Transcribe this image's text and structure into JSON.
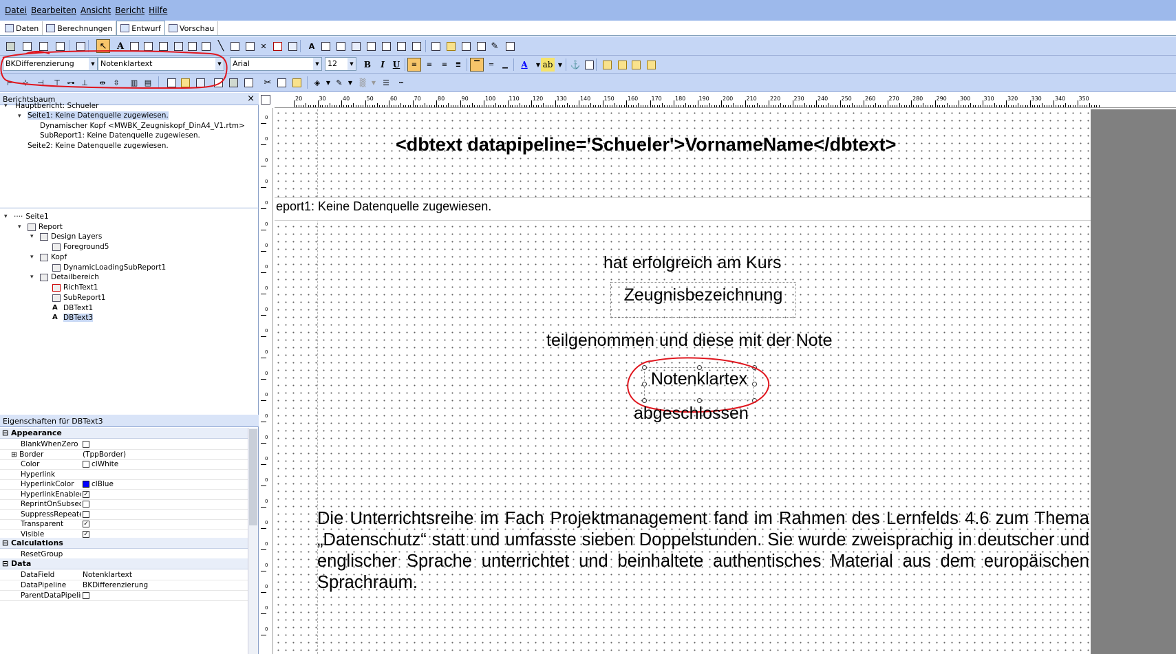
{
  "menu": [
    "Datei",
    "Bearbeiten",
    "Ansicht",
    "Bericht",
    "Hilfe"
  ],
  "tabs": [
    "Daten",
    "Berechnungen",
    "Entwurf",
    "Vorschau"
  ],
  "toolbar": {
    "pipeline": "BKDifferenzierung",
    "field": "Notenklartext",
    "font": "Arial",
    "size": "12",
    "bold": "B",
    "italic": "I",
    "underline": "U",
    "font_color_glyph": "A"
  },
  "tree": {
    "title": "Berichtsbaum",
    "close": "×",
    "nodes": [
      "Hauptbericht: Schueler",
      "Seite1: Keine Datenquelle zugewiesen.",
      "Dynamischer Kopf <MWBK_Zeugniskopf_DinA4_V1.rtm>",
      "SubReport1: Keine Datenquelle zugewiesen.",
      "Seite2: Keine Datenquelle zugewiesen."
    ]
  },
  "objects": [
    "Seite1",
    "Report",
    "Design Layers",
    "Foreground5",
    "Kopf",
    "DynamicLoadingSubReport1",
    "Detailbereich",
    "RichText1",
    "SubReport1",
    "DBText1",
    "DBText3"
  ],
  "props": {
    "title": "Eigenschaften für DBText3",
    "cat_appearance": "Appearance",
    "cat_calculations": "Calculations",
    "cat_data": "Data",
    "rows": [
      {
        "name": "BlankWhenZero",
        "value": "",
        "check": ""
      },
      {
        "name": "Border",
        "value": "(TppBorder)",
        "check": "none"
      },
      {
        "name": "Color",
        "value": "clWhite",
        "check": ""
      },
      {
        "name": "Hyperlink",
        "value": "",
        "check": "none"
      },
      {
        "name": "HyperlinkColor",
        "value": "clBlue",
        "check": "swatch"
      },
      {
        "name": "HyperlinkEnabled",
        "value": "",
        "check": "✓"
      },
      {
        "name": "ReprintOnSubsequ",
        "value": "",
        "check": ""
      },
      {
        "name": "SuppressRepeatec",
        "value": "",
        "check": ""
      },
      {
        "name": "Transparent",
        "value": "",
        "check": "✓"
      },
      {
        "name": "Visible",
        "value": "",
        "check": "✓"
      }
    ],
    "calc_rows": [
      {
        "name": "ResetGroup",
        "value": ""
      }
    ],
    "data_rows": [
      {
        "name": "DataField",
        "value": "Notenklartext"
      },
      {
        "name": "DataPipeline",
        "value": "BKDifferenzierung"
      },
      {
        "name": "ParentDataPipelin",
        "value": ""
      }
    ]
  },
  "ruler_labels": [
    "20",
    "30",
    "40",
    "50",
    "60",
    "70",
    "80",
    "90",
    "100",
    "110",
    "120",
    "130",
    "140",
    "150",
    "160",
    "170",
    "180",
    "190",
    "200",
    "210",
    "220",
    "230",
    "240",
    "250",
    "260",
    "270",
    "280",
    "290",
    "300",
    "310",
    "320",
    "330",
    "340",
    "350"
  ],
  "ruler_left_labels": [
    "0",
    "0",
    "0",
    "0",
    "0",
    "0",
    "0",
    "0",
    "0",
    "0",
    "0",
    "0",
    "0",
    "0",
    "0",
    "0",
    "0",
    "0",
    "0",
    "0",
    "0",
    "0",
    "0",
    "0",
    "0"
  ],
  "report": {
    "header_text": "<dbtext datapipeline='Schueler'>VornameName</dbtext>",
    "subreport_band": "eport1: Keine Datenquelle zugewiesen.",
    "line1": "hat erfolgreich am Kurs",
    "zeugnis": "Zeugnisbezeichnung",
    "line2": "teilgenommen und diese mit der Note",
    "note": "Notenklartex",
    "line3": "abgeschlossen",
    "paragraph": "Die Unterrichtsreihe im Fach Projektmanagement fand im Rahmen des Lernfelds 4.6 zum Thema „Datenschutz“ statt und umfasste sieben Doppelstunden. Sie wurde zweisprachig in deutscher und englischer Sprache unterrichtet und beinhaltete authentisches Material aus dem europäischen Sprachraum."
  },
  "colors": {
    "annotation": "#e0161e",
    "toolbar": "#c5d6f5",
    "menubar": "#9db9eb",
    "selection": "#f7c56a"
  }
}
